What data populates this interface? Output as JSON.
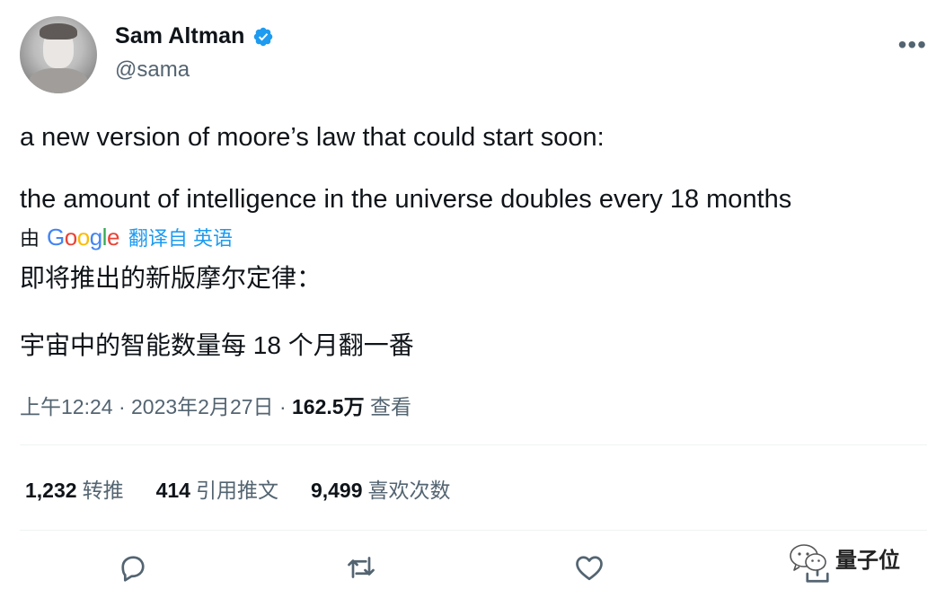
{
  "author": {
    "name": "Sam Altman",
    "handle": "@sama"
  },
  "tweet": {
    "lines": [
      "a new version of moore’s law that could start soon:",
      "the amount of intelligence in the universe doubles every 18 months"
    ]
  },
  "translation": {
    "by": "由",
    "provider": "Google",
    "label": "翻译自 英语",
    "lines": [
      "即将推出的新版摩尔定律：",
      "宇宙中的智能数量每 18 个月翻一番"
    ]
  },
  "meta": {
    "time": "上午12:24",
    "separator": "·",
    "date": "2023年2月27日",
    "views_count": "162.5万",
    "views_label": "查看"
  },
  "stats": {
    "retweets": {
      "count": "1,232",
      "label": "转推"
    },
    "quotes": {
      "count": "414",
      "label": "引用推文"
    },
    "likes": {
      "count": "9,499",
      "label": "喜欢次数"
    }
  },
  "more_label": "•••",
  "watermark": "量子位",
  "colors": {
    "accent": "#1d9bf0",
    "secondary_text": "#536471",
    "primary_text": "#0f1419"
  }
}
